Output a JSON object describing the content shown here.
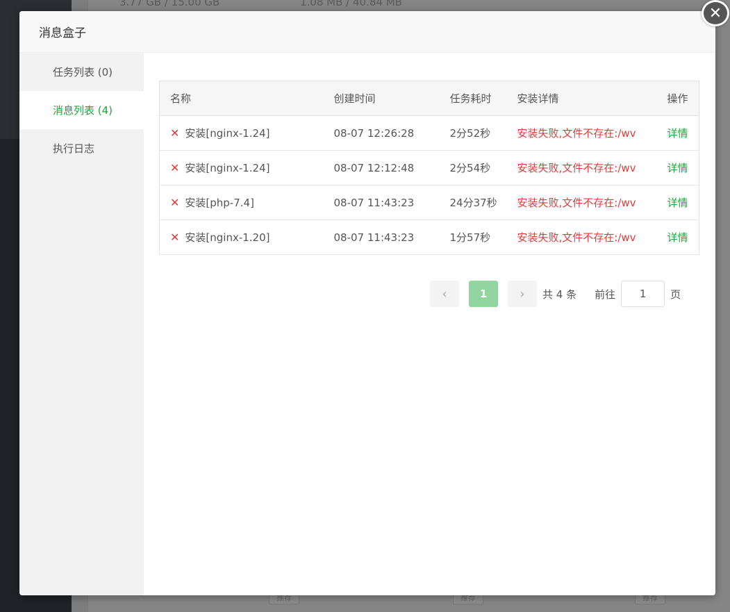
{
  "background": {
    "top_text_left": "3.77 GB / 15.00 GB",
    "top_text_right": "1.08 MB / 40.84 MB",
    "tag": "推荐"
  },
  "modal": {
    "title": "消息盒子",
    "close_icon": "close-icon"
  },
  "menu": {
    "items": [
      {
        "label": "任务列表 (0)"
      },
      {
        "label": "消息列表 (4)"
      },
      {
        "label": "执行日志"
      }
    ]
  },
  "table": {
    "headers": [
      "名称",
      "创建时间",
      "任务耗时",
      "安装详情",
      "操作"
    ],
    "rows": [
      {
        "name": "安装[nginx-1.24]",
        "time": "08-07 12:26:28",
        "duration": "2分52秒",
        "detail": "安装失败,文件不存在:/wv",
        "op": "详情"
      },
      {
        "name": "安装[nginx-1.24]",
        "time": "08-07 12:12:48",
        "duration": "2分54秒",
        "detail": "安装失败,文件不存在:/wv",
        "op": "详情"
      },
      {
        "name": "安装[php-7.4]",
        "time": "08-07 11:43:23",
        "duration": "24分37秒",
        "detail": "安装失败,文件不存在:/wv",
        "op": "详情"
      },
      {
        "name": "安装[nginx-1.20]",
        "time": "08-07 11:43:23",
        "duration": "1分57秒",
        "detail": "安装失败,文件不存在:/wv",
        "op": "详情"
      }
    ]
  },
  "pager": {
    "prev": "‹",
    "next": "›",
    "current": "1",
    "total": "共 4 条",
    "goto": "前往",
    "input_value": "1",
    "page_unit": "页"
  },
  "colors": {
    "accent": "#20a53a",
    "error": "#e03b3b"
  }
}
